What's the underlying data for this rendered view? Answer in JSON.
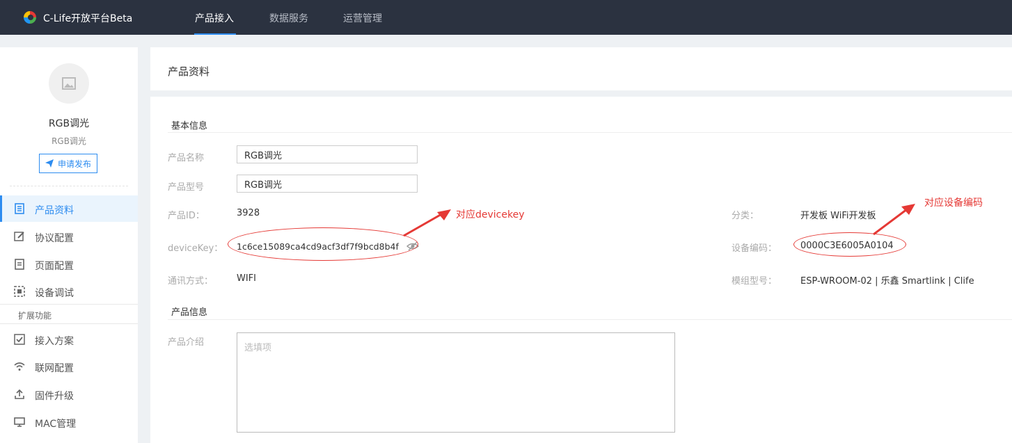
{
  "app": {
    "brand": "C-Life开放平台Beta",
    "nav": [
      {
        "label": "产品接入",
        "active": true
      },
      {
        "label": "数据服务",
        "active": false
      },
      {
        "label": "运营管理",
        "active": false
      }
    ]
  },
  "sidebar": {
    "product_name": "RGB调光",
    "product_sub": "RGB调光",
    "publish_label": "申请发布",
    "menu": [
      {
        "label": "产品资料",
        "icon": "document-icon",
        "active": true
      },
      {
        "label": "协议配置",
        "icon": "edit-icon",
        "active": false
      },
      {
        "label": "页面配置",
        "icon": "page-icon",
        "active": false
      },
      {
        "label": "设备调试",
        "icon": "debug-icon",
        "active": false
      }
    ],
    "ext_section_label": "扩展功能",
    "ext_menu": [
      {
        "label": "接入方案",
        "icon": "checkbox-icon"
      },
      {
        "label": "联网配置",
        "icon": "wifi-icon"
      },
      {
        "label": "固件升级",
        "icon": "upload-icon"
      },
      {
        "label": "MAC管理",
        "icon": "monitor-icon"
      }
    ]
  },
  "page": {
    "title": "产品资料",
    "basic_section": "基本信息",
    "product_section": "产品信息",
    "fields": {
      "name_label": "产品名称",
      "name_value": "RGB调光",
      "model_label": "产品型号",
      "model_value": "RGB调光",
      "id_label": "产品ID：",
      "id_value": "3928",
      "devicekey_label": "deviceKey：",
      "devicekey_value": "1c6ce15089ca4cd9acf3df7f9bcd8b4f",
      "comm_label": "通讯方式：",
      "comm_value": "WIFI",
      "category_label": "分类：",
      "category_value": "开发板 WiFi开发板",
      "devcode_label": "设备编码：",
      "devcode_value": "0000C3E6005A0104",
      "module_label": "模组型号：",
      "module_value": "ESP-WROOM-02 | 乐鑫 Smartlink | Clife",
      "intro_label": "产品介绍",
      "intro_placeholder": "选填项"
    },
    "annotations": {
      "devicekey_note": "对应devicekey",
      "devcode_note": "对应设备编码"
    }
  },
  "colors": {
    "topbar": "#2b3240",
    "accent": "#2d8cf0",
    "annotation": "#e53935"
  }
}
